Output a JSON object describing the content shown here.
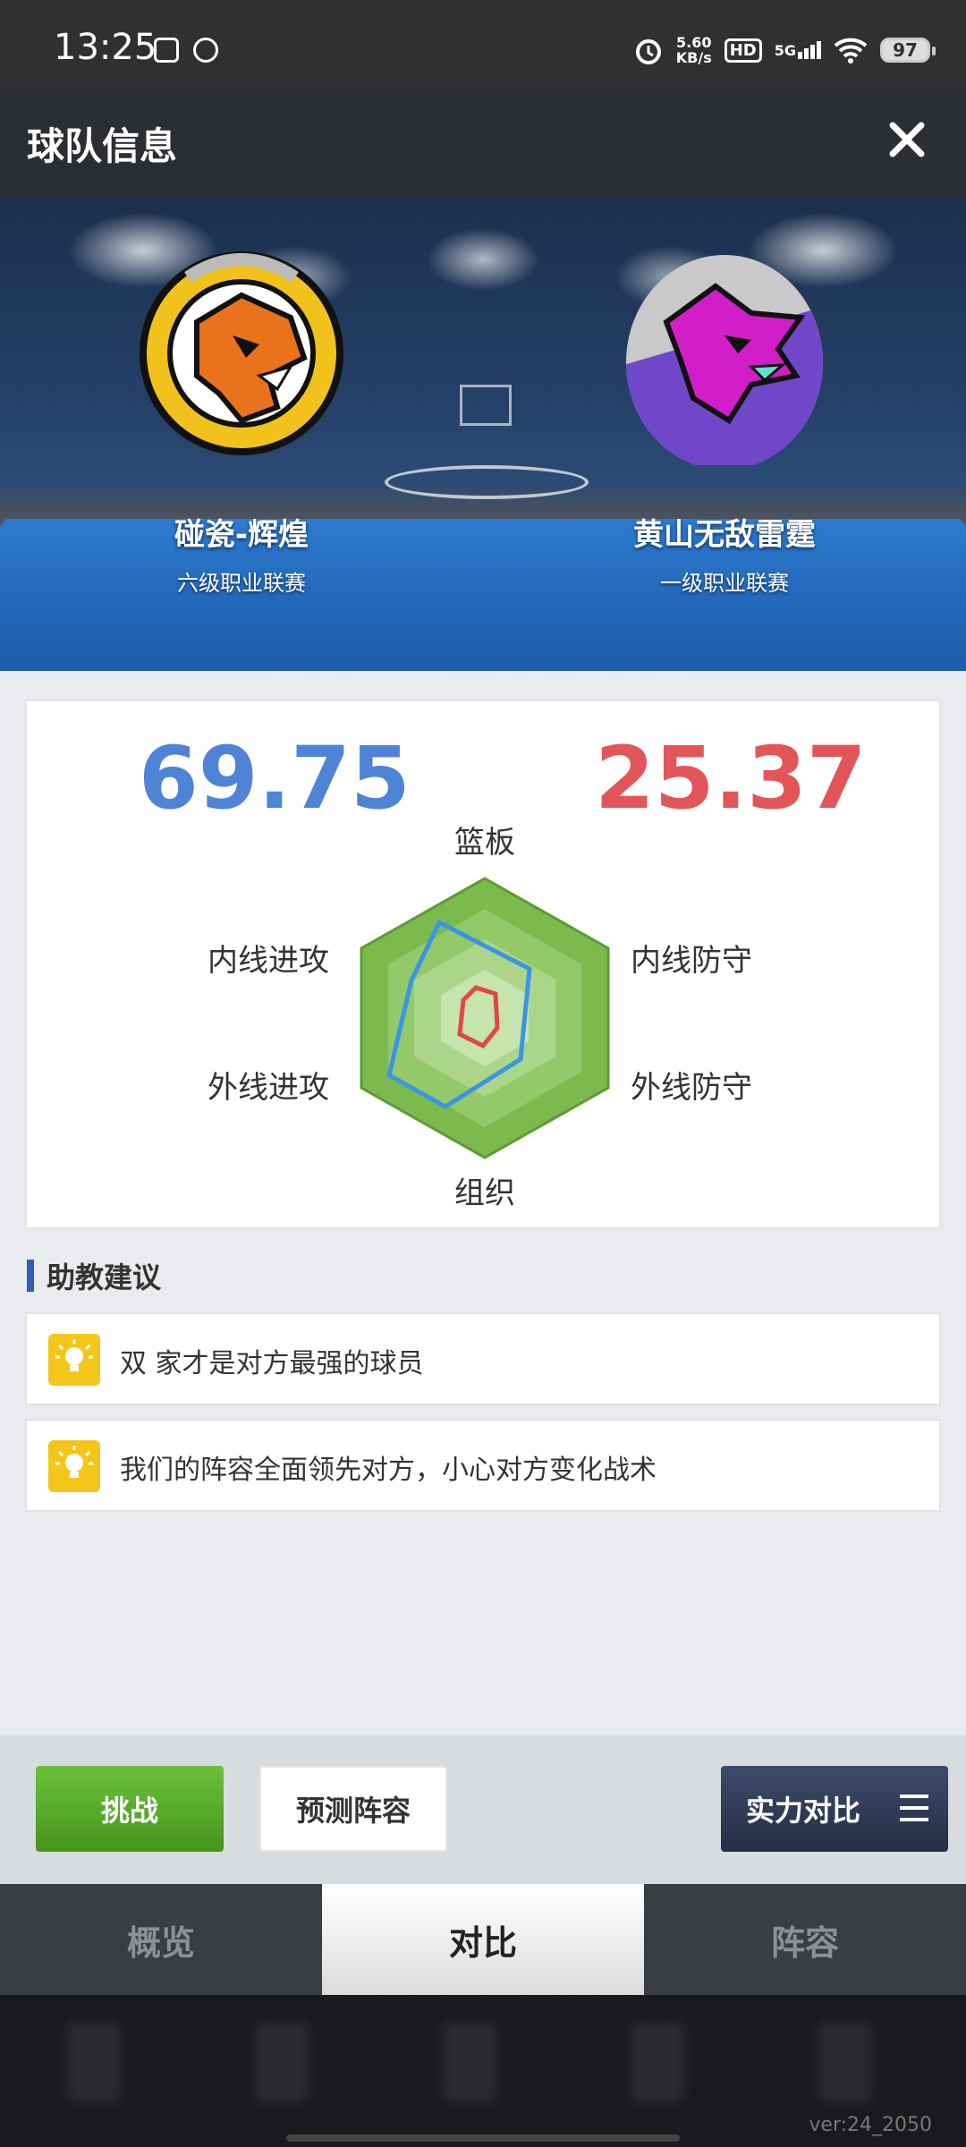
{
  "status_bar": {
    "time": "13:25",
    "speed_value": "5.60",
    "speed_unit": "KB/s",
    "hd": "HD",
    "network": "5G",
    "battery": "97"
  },
  "header": {
    "title": "球队信息"
  },
  "teams": {
    "home": {
      "name": "碰瓷-辉煌",
      "league": "六级职业联赛",
      "score": "69.75"
    },
    "away": {
      "name": "黄山无敌雷霆",
      "league": "一级职业联赛",
      "score": "25.37"
    }
  },
  "radar": {
    "axes": [
      "篮板",
      "内线防守",
      "外线防守",
      "组织",
      "外线进攻",
      "内线进攻"
    ],
    "colors": {
      "home": "#3b95e6",
      "away": "#e04848",
      "fill": "#7cba4e"
    }
  },
  "assistant": {
    "heading": "助教建议",
    "tips": [
      "双 家才是对方最强的球员",
      "我们的阵容全面领先对方，小心对方变化战术"
    ]
  },
  "actions": {
    "challenge": "挑战",
    "predict": "预测阵容",
    "compare": "实力对比"
  },
  "tabs": [
    "概览",
    "对比",
    "阵容"
  ],
  "active_tab": "对比",
  "version": "ver:24_2050"
}
